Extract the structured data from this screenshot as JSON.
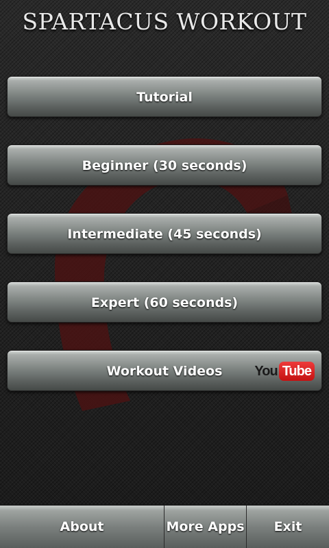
{
  "app": {
    "title": "SPARTACUS WORKOUT"
  },
  "menu": {
    "tutorial": "Tutorial",
    "beginner": "Beginner (30 seconds)",
    "intermediate": "Intermediate (45 seconds)",
    "expert": "Expert (60 seconds)",
    "videos": "Workout Videos",
    "youtube_logo": {
      "you": "You",
      "tube": "Tube"
    }
  },
  "bottom_bar": {
    "about": "About",
    "more_apps": "More Apps",
    "exit": "Exit"
  },
  "colors": {
    "background": "#1e1e1e",
    "emblem": "#4a1313",
    "button_top": "#d6dad8",
    "button_bottom": "#454947",
    "youtube_red": "#cc181e"
  },
  "icons": {
    "emblem": "spartan-helmet-icon",
    "youtube": "youtube-logo-icon"
  }
}
